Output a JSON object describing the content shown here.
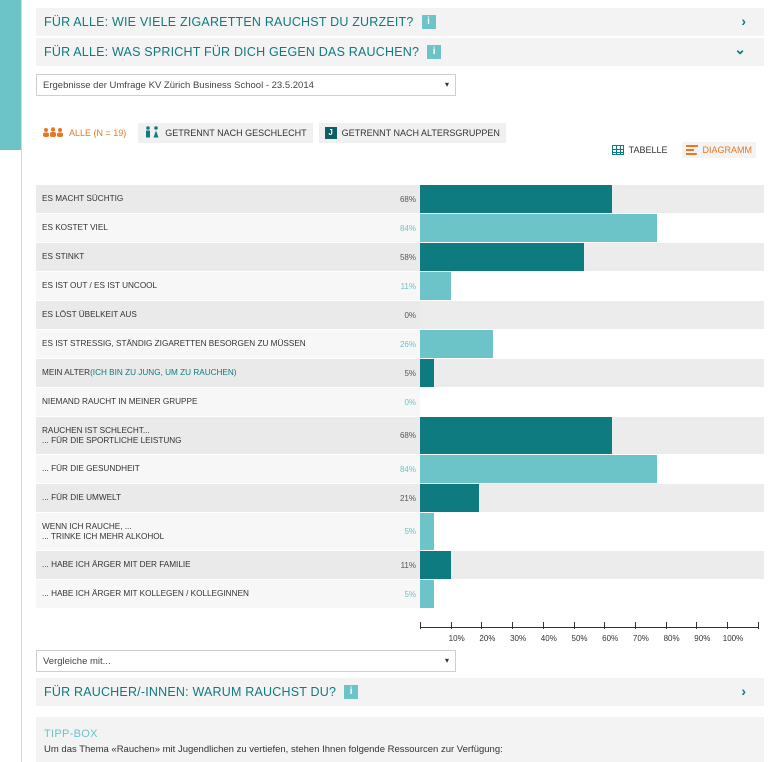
{
  "accordion": [
    {
      "title": "FÜR ALLE: WIE VIELE ZIGARETTEN RAUCHST DU ZURZEIT?",
      "info": "i",
      "chevron": "›"
    },
    {
      "title": "FÜR ALLE: WAS SPRICHT FÜR DICH GEGEN DAS RAUCHEN?",
      "info": "i",
      "chevron": "⌄"
    },
    {
      "title": "FÜR RAUCHER/-INNEN: WARUM RAUCHST DU?",
      "info": "i",
      "chevron": "›"
    }
  ],
  "survey_select": {
    "value": "Ergebnisse der Umfrage KV Zürich Business School - 23.5.2014",
    "caret": "▾"
  },
  "filters": [
    {
      "label": "ALLE (N = 19)",
      "icon": "group-icon",
      "active": true
    },
    {
      "label": "GETRENNT NACH GESCHLECHT",
      "icon": "gender-icon",
      "active": false
    },
    {
      "label": "GETRENNT NACH ALTERSGRUPPEN",
      "icon": "age-icon",
      "badge": "J",
      "active": false
    }
  ],
  "view_toggle": {
    "table_label": "TABELLE",
    "chart_label": "DIAGRAMM"
  },
  "colors": {
    "dark": "#0d7b80",
    "light": "#6cc3c8",
    "accent": "#e87722"
  },
  "chart_data": {
    "type": "bar",
    "orientation": "horizontal",
    "categories": [
      "ES MACHT SÜCHTIG",
      "ES KOSTET VIEL",
      "ES STINKT",
      "ES IST OUT / ES IST UNCOOL",
      "ES LÖST ÜBELKEIT AUS",
      "ES IST STRESSIG, STÄNDIG ZIGARETTEN BESORGEN ZU MÜSSEN",
      "MEIN ALTER (ICH BIN ZU JUNG, UM ZU RAUCHEN)",
      "NIEMAND RAUCHT IN MEINER GRUPPE",
      "RAUCHEN IST SCHLECHT...\n... FÜR DIE SPORTLICHE LEISTUNG",
      "... FÜR DIE GESUNDHEIT",
      "... FÜR DIE UMWELT",
      "WENN ICH RAUCHE, ...\n... TRINKE ICH MEHR ALKOHOL",
      "... HABE ICH ÄRGER MIT DER FAMILIE",
      "... HABE ICH ÄRGER MIT KOLLEGEN / KOLLEGINNEN"
    ],
    "values": [
      68,
      84,
      58,
      11,
      0,
      26,
      5,
      0,
      68,
      84,
      21,
      5,
      11,
      5
    ],
    "value_labels": [
      "68%",
      "84%",
      "58%",
      "11%",
      "0%",
      "26%",
      "5%",
      "0%",
      "68%",
      "84%",
      "21%",
      "5%",
      "11%",
      "5%"
    ],
    "x_ticks": [
      "10%",
      "20%",
      "30%",
      "40%",
      "50%",
      "60%",
      "70%",
      "80%",
      "90%",
      "100%"
    ],
    "xlim": [
      0,
      110
    ]
  },
  "compare_select": {
    "value": "Vergleiche mit...",
    "caret": "▾"
  },
  "tipp": {
    "title": "TIPP-BOX",
    "text": "Um das Thema «Rauchen» mit Jugendlichen zu vertiefen, stehen Ihnen folgende Ressourcen zur Verfügung:"
  }
}
